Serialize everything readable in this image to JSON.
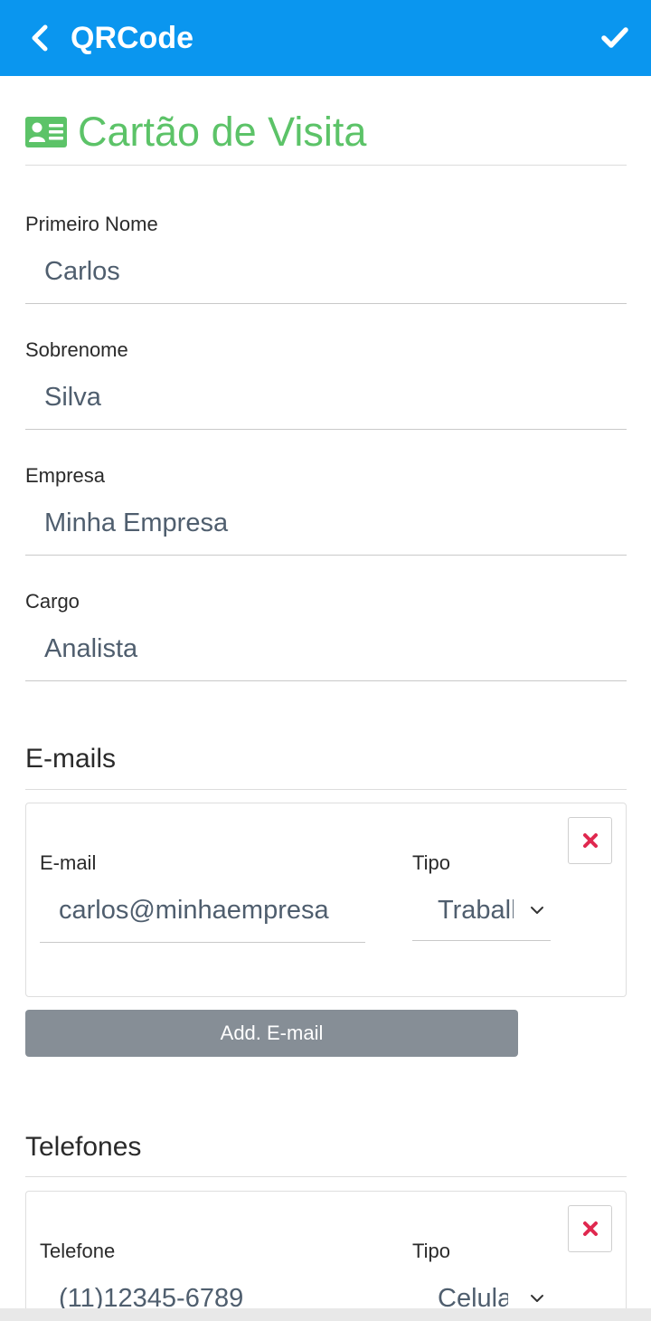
{
  "header": {
    "title": "QRCode",
    "back_icon": "chevron-left-icon",
    "confirm_icon": "checkmark-icon",
    "bar_color": "#0a96ef"
  },
  "page": {
    "title": "Cartão de Visita",
    "title_icon": "id-card-icon",
    "accent_color": "#5cc368"
  },
  "form": {
    "first_name": {
      "label": "Primeiro Nome",
      "value": "Carlos"
    },
    "last_name": {
      "label": "Sobrenome",
      "value": "Silva"
    },
    "company": {
      "label": "Empresa",
      "value": "Minha Empresa"
    },
    "job_title": {
      "label": "Cargo",
      "value": "Analista"
    }
  },
  "emails": {
    "section_title": "E-mails",
    "entries": [
      {
        "field_label": "E-mail",
        "value": "carlos@minhaempresa",
        "type_label": "Tipo",
        "type_value": "Trabalho"
      }
    ],
    "add_button_label": "Add. E-mail",
    "remove_icon": "close-x-icon",
    "remove_icon_color": "#e0284f"
  },
  "phones": {
    "section_title": "Telefones",
    "entries": [
      {
        "field_label": "Telefone",
        "value": "(11)12345-6789",
        "type_label": "Tipo",
        "type_value": "Celular"
      }
    ],
    "remove_icon": "close-x-icon"
  }
}
